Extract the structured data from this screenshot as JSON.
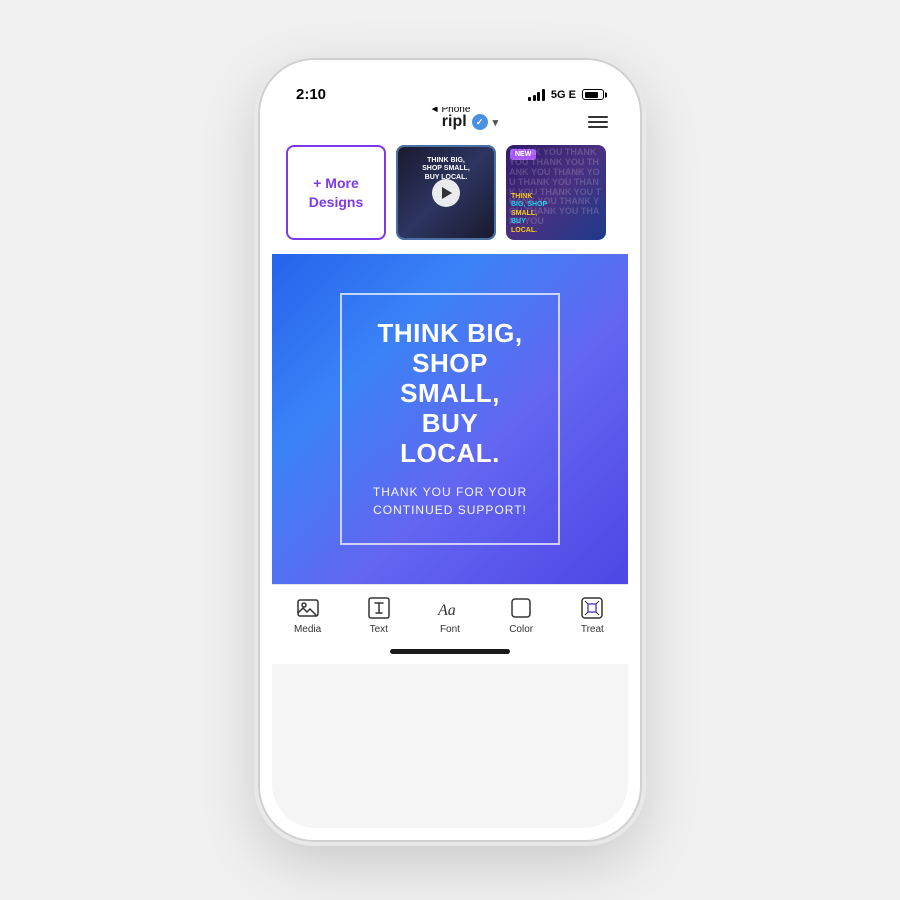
{
  "phone": {
    "status_bar": {
      "time": "2:10",
      "back_label": "Phone",
      "network": "5G E",
      "battery_pct": 80
    },
    "header": {
      "back_text": "◄ Phone",
      "app_name": "ripl",
      "verified": true,
      "dropdown_arrow": "▾",
      "menu_label": "menu"
    },
    "thumbnails": {
      "more_designs_label": "+ More\nDesigns",
      "new_badge": "NEW",
      "thumb2_text": "THINK BIG, SHOP SMALL, BUY LOCAL",
      "thumb3_lines": [
        {
          "text": "THINK",
          "color": "yellow"
        },
        {
          "text": "BIG, SHOP",
          "color": "cyan"
        },
        {
          "text": "SMALL,",
          "color": "yellow"
        },
        {
          "text": "BUY",
          "color": "cyan"
        },
        {
          "text": "LOCAL.",
          "color": "yellow"
        }
      ],
      "thank_you_words": [
        "THANK YOU",
        "THANK YOU",
        "THANK YOU",
        "THANK YOU",
        "THANK YOU",
        "THANK YOU"
      ]
    },
    "design_preview": {
      "main_text": "THINK BIG, SHOP SMALL, BUY LOCAL.",
      "sub_text": "THANK YOU FOR YOUR CONTINUED SUPPORT!"
    },
    "toolbar": {
      "items": [
        {
          "id": "media",
          "label": "Media",
          "icon": "media"
        },
        {
          "id": "text",
          "label": "Text",
          "icon": "text"
        },
        {
          "id": "font",
          "label": "Font",
          "icon": "font"
        },
        {
          "id": "color",
          "label": "Color",
          "icon": "color"
        },
        {
          "id": "treat",
          "label": "Treat",
          "icon": "treat"
        }
      ]
    },
    "home_indicator": true
  }
}
